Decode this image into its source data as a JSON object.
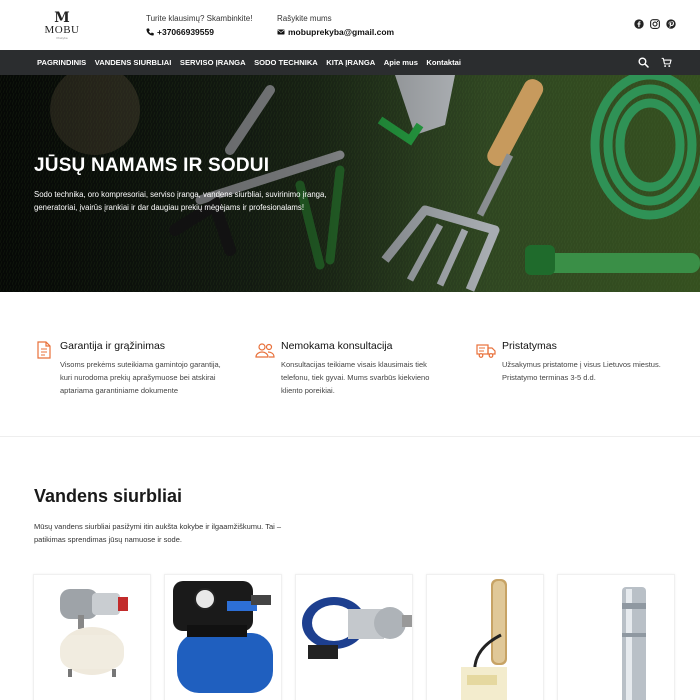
{
  "header": {
    "logo_mark": "M",
    "logo_name": "MOBU",
    "logo_sub": "Prekyba",
    "phone_label": "Turite klausimų? Skambinkite!",
    "phone": "+37066939559",
    "email_label": "Rašykite mums",
    "email": "mobuprekyba@gmail.com",
    "social_icons": [
      "facebook-icon",
      "instagram-icon",
      "pinterest-icon"
    ]
  },
  "nav": {
    "items": [
      "PAGRINDINIS",
      "VANDENS SIURBLIAI",
      "SERVISO ĮRANGA",
      "SODO TECHNIKA",
      "KITA ĮRANGA",
      "Apie mus",
      "Kontaktai"
    ],
    "icons": [
      "search-icon",
      "cart-icon"
    ]
  },
  "hero": {
    "title": "JŪSŲ NAMAMS IR SODUI",
    "text": "Sodo technika, oro kompresoriai, serviso įranga, vandens siurbliai, suvirinimo įranga, generatoriai, įvairūs įrankiai ir dar daugiau prekių mėgėjams ir profesionalams!"
  },
  "features": [
    {
      "icon": "document-icon",
      "title": "Garantija ir grąžinimas",
      "text": "Visoms prekėms suteikiama gamintojo garantija, kuri nurodoma prekių aprašymuose bei atskirai aptariama garantiniame dokumente"
    },
    {
      "icon": "users-icon",
      "title": "Nemokama konsultacija",
      "text": "Konsultacijas teikiame visais klausimais tiek telefonu, tiek gyvai. Mums svarbūs kiekvieno kliento poreikiai."
    },
    {
      "icon": "truck-icon",
      "title": "Pristatymas",
      "text": "Užsakymus pristatome į visus Lietuvos miestus. Pristatymo terminas 3-5 d.d."
    }
  ],
  "section": {
    "title": "Vandens siurbliai",
    "text": "Mūsų vandens siurbliai pasižymi itin aukšta kokybe ir ilgaamžiškumu. Tai – patikimas sprendimas jūsų namuose ir sode."
  },
  "colors": {
    "accent": "#e8703a",
    "nav_bg": "#2b2d2f",
    "text_dark": "#1a1a1a"
  }
}
